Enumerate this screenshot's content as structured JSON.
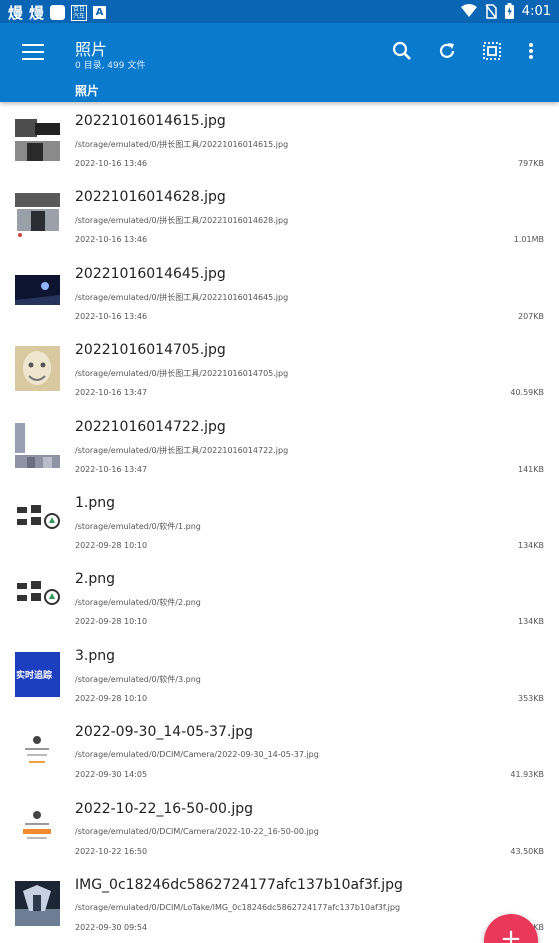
{
  "status_bar": {
    "left_glyphs": [
      "熳",
      "熳"
    ],
    "box_text": "百日 汽车",
    "a_icon": "A",
    "time": "4:01"
  },
  "app_bar": {
    "title": "照片",
    "subtitle": "0 目录, 499 文件",
    "breadcrumb": "照片",
    "icons": [
      "menu-icon",
      "search-icon",
      "refresh-icon",
      "select-all-icon",
      "more-vert-icon"
    ]
  },
  "colors": {
    "status_bar": "#0a66b4",
    "app_bar": "#0a7acd",
    "fab": "#e9385a"
  },
  "files": [
    {
      "name": "20221016014615.jpg",
      "path": "/storage/emulated/0/拼长图工具/20221016014615.jpg",
      "date": "2022-10-16 13:46",
      "size": "797KB"
    },
    {
      "name": "20221016014628.jpg",
      "path": "/storage/emulated/0/拼长图工具/20221016014628.jpg",
      "date": "2022-10-16 13:46",
      "size": "1.01MB"
    },
    {
      "name": "20221016014645.jpg",
      "path": "/storage/emulated/0/拼长图工具/20221016014645.jpg",
      "date": "2022-10-16 13:46",
      "size": "207KB"
    },
    {
      "name": "20221016014705.jpg",
      "path": "/storage/emulated/0/拼长图工具/20221016014705.jpg",
      "date": "2022-10-16 13:47",
      "size": "40.59KB"
    },
    {
      "name": "20221016014722.jpg",
      "path": "/storage/emulated/0/拼长图工具/20221016014722.jpg",
      "date": "2022-10-16 13:47",
      "size": "141KB"
    },
    {
      "name": "1.png",
      "path": "/storage/emulated/0/软件/1.png",
      "date": "2022-09-28 10:10",
      "size": "134KB"
    },
    {
      "name": "2.png",
      "path": "/storage/emulated/0/软件/2.png",
      "date": "2022-09-28 10:10",
      "size": "134KB"
    },
    {
      "name": "3.png",
      "path": "/storage/emulated/0/软件/3.png",
      "date": "2022-09-28 10:10",
      "size": "353KB"
    },
    {
      "name": "2022-09-30_14-05-37.jpg",
      "path": "/storage/emulated/0/DCIM/Camera/2022-09-30_14-05-37.jpg",
      "date": "2022-09-30 14:05",
      "size": "41.93KB"
    },
    {
      "name": "2022-10-22_16-50-00.jpg",
      "path": "/storage/emulated/0/DCIM/Camera/2022-10-22_16-50-00.jpg",
      "date": "2022-10-22 16:50",
      "size": "43.50KB"
    },
    {
      "name": "IMG_0c18246dc5862724177afc137b10af3f.jpg",
      "path": "/storage/emulated/0/DCIM/LoTake/IMG_0c18246dc5862724177afc137b10af3f.jpg",
      "date": "2022-09-30 09:54",
      "size": "KB"
    }
  ],
  "thumbnails": [
    {
      "text": ""
    },
    {
      "text": ""
    },
    {
      "text": ""
    },
    {
      "text": ""
    },
    {
      "text": ""
    },
    {
      "text": ""
    },
    {
      "text": ""
    },
    {
      "text": "实时追踪"
    },
    {
      "text": ""
    },
    {
      "text": ""
    },
    {
      "text": ""
    }
  ],
  "fab": {
    "label": "+"
  }
}
